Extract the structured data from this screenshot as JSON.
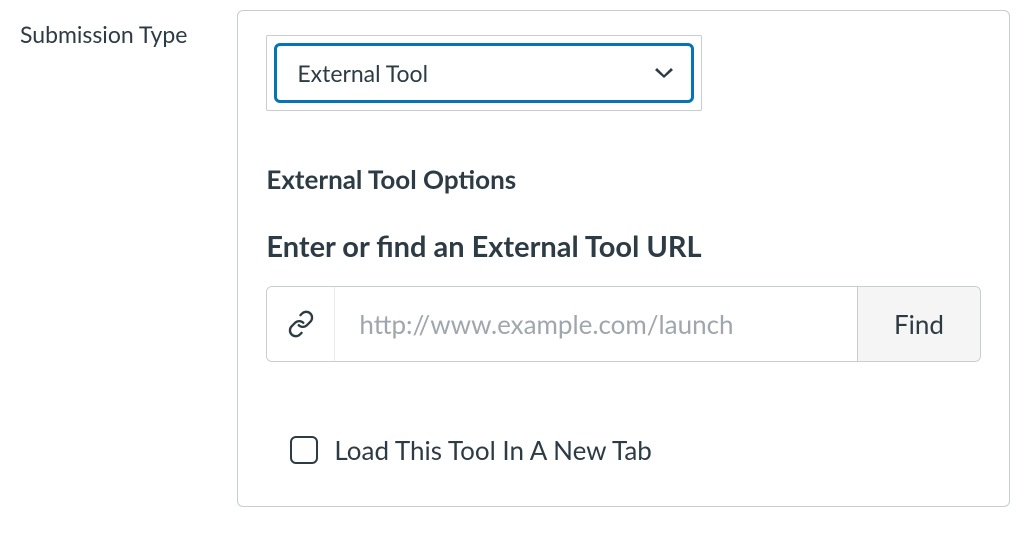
{
  "form": {
    "submission_type_label": "Submission Type",
    "submission_type_value": "External Tool"
  },
  "external_tool": {
    "options_heading": "External Tool Options",
    "url_heading": "Enter or find an External Tool URL",
    "url_value": "",
    "url_placeholder": "http://www.example.com/launch",
    "find_label": "Find",
    "new_tab_label": "Load This Tool In A New Tab",
    "new_tab_checked": false
  }
}
